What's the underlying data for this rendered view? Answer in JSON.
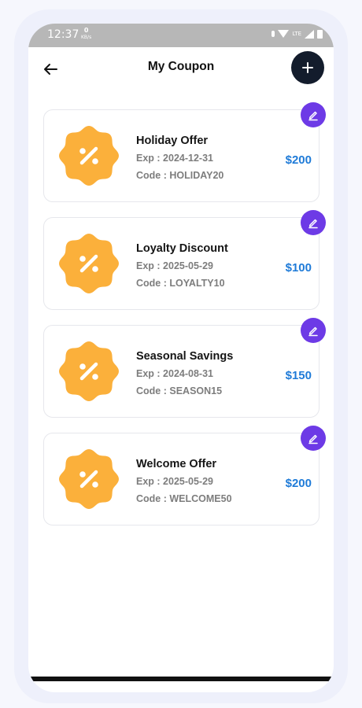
{
  "status": {
    "time": "12:37",
    "speed_value": "0",
    "speed_unit": "KB/s",
    "network": "LTE"
  },
  "header": {
    "title": "My Coupon"
  },
  "coupons": [
    {
      "name": "Holiday Offer",
      "exp_label": "Exp :",
      "exp": "2024-12-31",
      "code_label": "Code :",
      "code": "HOLIDAY20",
      "amount": "$200"
    },
    {
      "name": "Loyalty Discount",
      "exp_label": "Exp :",
      "exp": "2025-05-29",
      "code_label": "Code :",
      "code": "LOYALTY10",
      "amount": "$100"
    },
    {
      "name": "Seasonal Savings",
      "exp_label": "Exp :",
      "exp": "2024-08-31",
      "code_label": "Code :",
      "code": "SEASON15",
      "amount": "$150"
    },
    {
      "name": "Welcome Offer",
      "exp_label": "Exp :",
      "exp": "2025-05-29",
      "code_label": "Code :",
      "code": "WELCOME50",
      "amount": "$200"
    }
  ],
  "icons": {
    "back": "arrow-left-icon",
    "add": "plus-icon",
    "edit": "pencil-icon",
    "badge": "percent-badge-icon"
  },
  "colors": {
    "accent_blue": "#1f7bd8",
    "edit_purple": "#6d3ae6",
    "badge_orange": "#fbb03b",
    "add_button": "#131c2c"
  }
}
